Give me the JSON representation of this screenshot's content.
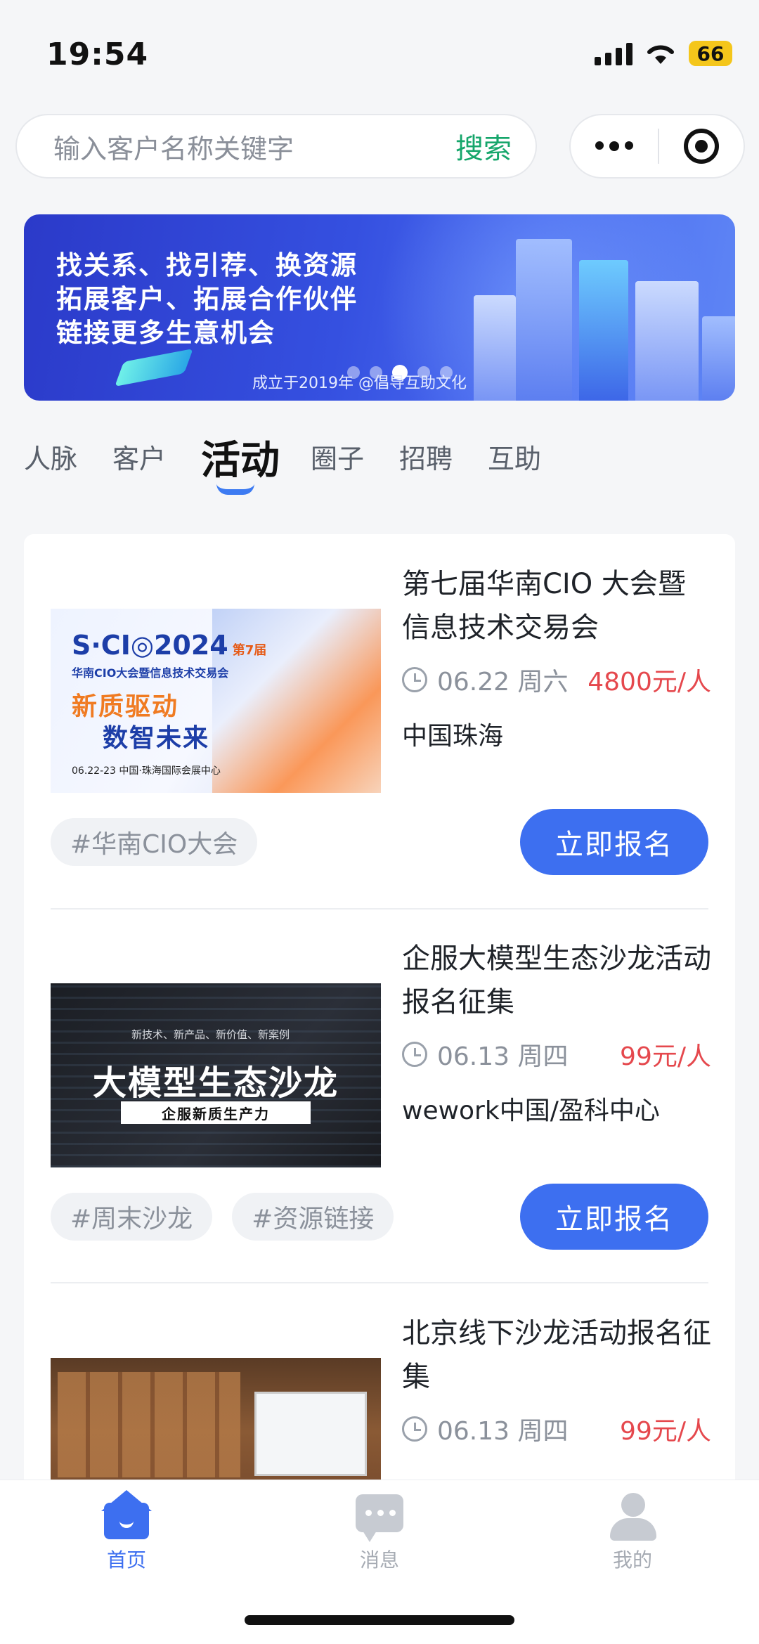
{
  "status_bar": {
    "time": "19:54",
    "battery": "66"
  },
  "search": {
    "placeholder": "输入客户名称关键字",
    "button": "搜索"
  },
  "banner": {
    "lines": [
      "找关系、找引荐、换资源",
      "拓展客户、拓展合作伙伴",
      "链接更多生意机会"
    ],
    "subtitle": "成立于2019年 @倡导互助文化",
    "active_dot": 3,
    "dot_count": 5
  },
  "tabs": [
    {
      "label": "人脉",
      "active": false
    },
    {
      "label": "客户",
      "active": false
    },
    {
      "label": "活动",
      "active": true
    },
    {
      "label": "圈子",
      "active": false
    },
    {
      "label": "招聘",
      "active": false
    },
    {
      "label": "互助",
      "active": false
    }
  ],
  "events": [
    {
      "title": "第七届华南CIO 大会暨信息技术交易会",
      "date": "06.22 周六",
      "price": "4800元/人",
      "location": "中国珠海",
      "tags": [
        "#华南CIO大会"
      ],
      "signup": "立即报名",
      "thumb": {
        "logo": "S·CI◎2024",
        "edition": "第7届",
        "line2": "华南CIO大会暨信息技术交易会",
        "line3": "新质驱动",
        "line4": "数智未来",
        "line5": "06.22-23    中国·珠海国际会展中心"
      }
    },
    {
      "title": "企服大模型生态沙龙活动报名征集",
      "date": "06.13 周四",
      "price": "99元/人",
      "location": "wework中国/盈科中心",
      "tags": [
        "#周末沙龙",
        "#资源链接"
      ],
      "signup": "立即报名",
      "thumb": {
        "small": "新技术、新产品、新价值、新案例",
        "big": "大模型生态沙龙",
        "bar": "企服新质生产力"
      }
    },
    {
      "title": "北京线下沙龙活动报名征集",
      "date": "06.13 周四",
      "price": "99元/人"
    }
  ],
  "bottom_nav": [
    {
      "label": "首页",
      "icon": "home-icon",
      "active": true
    },
    {
      "label": "消息",
      "icon": "message-icon",
      "active": false
    },
    {
      "label": "我的",
      "icon": "user-icon",
      "active": false
    }
  ],
  "colors": {
    "accent": "#3d6ff0",
    "price": "#e5484d",
    "search_button": "#16a66b"
  }
}
